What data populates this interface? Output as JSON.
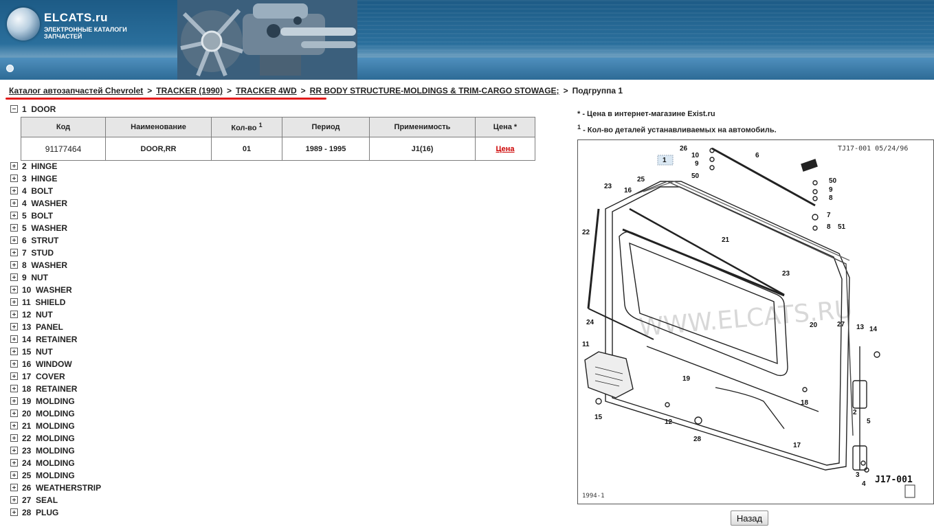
{
  "header": {
    "logo": "ELCATS.ru",
    "subtitle": "ЭЛЕКТРОННЫЕ КАТАЛОГИ ЗАПЧАСТЕЙ"
  },
  "breadcrumb": {
    "items": [
      "Каталог автозапчастей Chevrolet",
      "TRACKER (1990)",
      "TRACKER 4WD",
      "RR BODY STRUCTURE-MOLDINGS & TRIM-CARGO STOWAGE;"
    ],
    "current": "Подгруппа 1",
    "separator": ">"
  },
  "tree": {
    "expanded": {
      "label": "1  DOOR"
    },
    "items": [
      "2  HINGE",
      "3  HINGE",
      "4  BOLT",
      "4  WASHER",
      "5  BOLT",
      "5  WASHER",
      "6  STRUT",
      "7  STUD",
      "8  WASHER",
      "9  NUT",
      "10  WASHER",
      "11  SHIELD",
      "12  NUT",
      "13  PANEL",
      "14  RETAINER",
      "15  NUT",
      "16  WINDOW",
      "17  COVER",
      "18  RETAINER",
      "19  MOLDING",
      "20  MOLDING",
      "21  MOLDING",
      "22  MOLDING",
      "23  MOLDING",
      "24  MOLDING",
      "25  MOLDING",
      "26  WEATHERSTRIP",
      "27  SEAL",
      "28  PLUG"
    ]
  },
  "table": {
    "headers": {
      "code": "Код",
      "name": "Наименование",
      "qty": "Кол-во",
      "qty_sup": "1",
      "period": "Период",
      "applicability": "Применимость",
      "price": "Цена *"
    },
    "row": {
      "code": "91177464",
      "name": "DOOR,RR",
      "qty": "01",
      "period": "1989 - 1995",
      "applicability": "J1(16)",
      "price": "Цена"
    }
  },
  "notes": {
    "price_note_mark": "*",
    "price_note": " - Цена в интернет-магазине Exist.ru",
    "qty_note_mark": "1",
    "qty_note": " - Кол-во деталей устанавливаемых на автомобиль."
  },
  "diagram": {
    "ref": "TJ17-001  05/24/96",
    "code": "J17-001",
    "year": "1994-1",
    "watermark": "WWW.ELCATS.RU",
    "callouts": [
      "1",
      "26",
      "10",
      "9",
      "50",
      "6",
      "23",
      "25",
      "16",
      "50",
      "9",
      "8",
      "7",
      "8",
      "51",
      "22",
      "21",
      "23",
      "24",
      "20",
      "27",
      "13",
      "14",
      "11",
      "19",
      "2",
      "18",
      "15",
      "12",
      "5",
      "28",
      "17",
      "3",
      "4"
    ]
  },
  "buttons": {
    "back": "Назад"
  }
}
